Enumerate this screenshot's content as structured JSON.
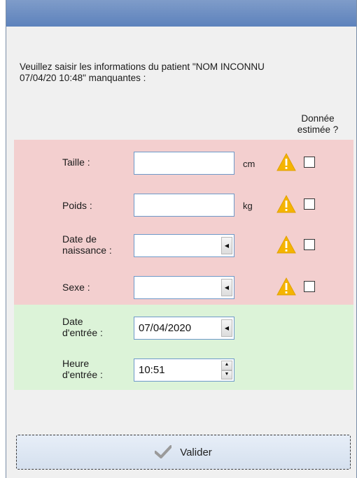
{
  "intro": "Veuillez saisir les informations du patient \"NOM INCONNU\n07/04/20 10:48\" manquantes :",
  "estimated_header": "Donnée\nestimée ?",
  "fields": {
    "taille": {
      "label": "Taille :",
      "value": "",
      "unit": "cm"
    },
    "poids": {
      "label": "Poids :",
      "value": "",
      "unit": "kg"
    },
    "date_naissance": {
      "label": "Date de\nnaissance :",
      "value": ""
    },
    "sexe": {
      "label": "Sexe :",
      "value": ""
    },
    "date_entree": {
      "label": "Date\nd'entrée :",
      "value": "07/04/2020"
    },
    "heure_entree": {
      "label": "Heure\nd'entrée :",
      "value": "10:51"
    }
  },
  "button": {
    "label": "Valider"
  },
  "colors": {
    "required_band": "#f3cfcf",
    "ok_band": "#dcf3d8",
    "warning": "#f5b400"
  }
}
